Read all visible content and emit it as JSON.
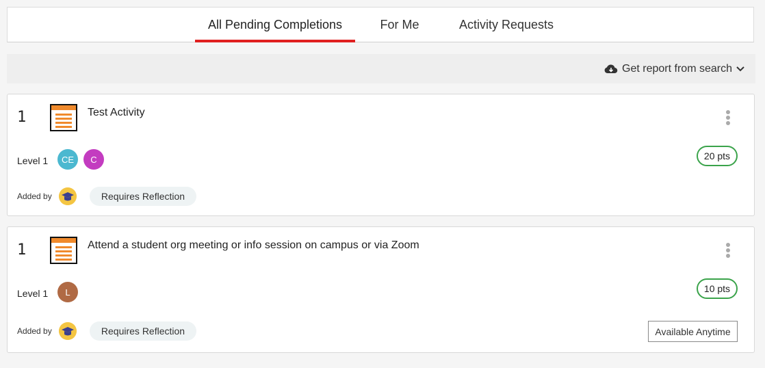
{
  "tabs": [
    {
      "label": "All Pending Completions",
      "active": true
    },
    {
      "label": "For Me",
      "active": false
    },
    {
      "label": "Activity Requests",
      "active": false
    }
  ],
  "toolbar": {
    "report_label": "Get report from search",
    "icon": "cloud-download-icon"
  },
  "cards": [
    {
      "rank": "1",
      "title": "Test Activity",
      "level": "Level 1",
      "avatars": [
        {
          "initials": "CE",
          "color": "#4bb8d0"
        },
        {
          "initials": "C",
          "color": "#c33cc0"
        }
      ],
      "points": "20 pts",
      "added_by": "Added by",
      "tag": "Requires Reflection"
    },
    {
      "rank": "1",
      "title": "Attend a student org meeting or info session on campus or via Zoom",
      "level": "Level 1",
      "avatars": [
        {
          "initials": "L",
          "color": "#b06a44"
        }
      ],
      "points": "10 pts",
      "added_by": "Added by",
      "tag": "Requires Reflection",
      "availability": "Available Anytime"
    }
  ],
  "colors": {
    "accent": "#e02020",
    "points_border": "#3aa34a"
  }
}
